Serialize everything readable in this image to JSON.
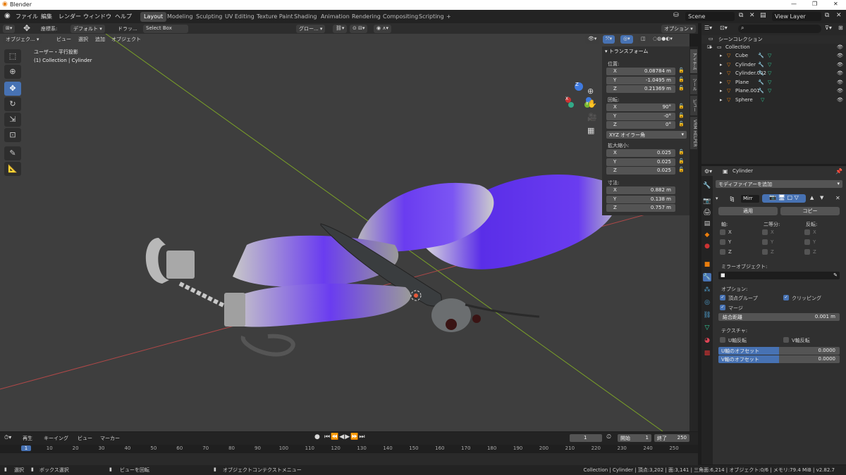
{
  "app": {
    "title": "Blender",
    "icon": "blender-logo"
  },
  "menu": {
    "items": [
      "ファイル",
      "編集",
      "レンダー",
      "ウィンドウ",
      "ヘルプ"
    ],
    "workspaces": [
      "Layout",
      "Modeling",
      "Sculpting",
      "UV Editing",
      "Texture Paint",
      "Shading",
      "Animation",
      "Rendering",
      "Compositing",
      "Scripting"
    ],
    "add_tab": "+",
    "scene": "Scene",
    "view_layer": "View Layer"
  },
  "header": {
    "coord_label": "座標系:",
    "coord_value": "デフォルト",
    "drag_label": "ドラッ...",
    "drag_value": "Select Box",
    "pivot": "グロー...",
    "options": "オプション"
  },
  "viewport": {
    "mode": "オブジェク...",
    "menus": [
      "ビュー",
      "選択",
      "追加",
      "オブジェクト"
    ],
    "overlay_title": "ユーザー・平行投影",
    "overlay_sub": "(1) Collection | Cylinder",
    "axes": {
      "x": "X",
      "y": "Y",
      "z": "Z"
    }
  },
  "npanel": {
    "section": "トランスフォーム",
    "location_label": "位置:",
    "location": [
      {
        "axis": "X",
        "value": "0.08784 m"
      },
      {
        "axis": "Y",
        "value": "-1.0495 m"
      },
      {
        "axis": "Z",
        "value": "0.21369 m"
      }
    ],
    "rotation_label": "回転:",
    "rotation": [
      {
        "axis": "X",
        "value": "90°"
      },
      {
        "axis": "Y",
        "value": "-0°"
      },
      {
        "axis": "Z",
        "value": "0°"
      }
    ],
    "rot_mode": "XYZ オイラー角",
    "scale_label": "拡大縮小:",
    "scale": [
      {
        "axis": "X",
        "value": "0.025"
      },
      {
        "axis": "Y",
        "value": "0.025"
      },
      {
        "axis": "Z",
        "value": "0.025"
      }
    ],
    "dims_label": "寸法:",
    "dims": [
      {
        "axis": "X",
        "value": "0.882 m"
      },
      {
        "axis": "Y",
        "value": "0.138 m"
      },
      {
        "axis": "Z",
        "value": "0.757 m"
      }
    ],
    "tabs": [
      "アイテム",
      "ツール",
      "ビュー",
      "VRM HELPER"
    ]
  },
  "outliner": {
    "root": "シーンコレクション",
    "collection": "Collection",
    "objects": [
      "Cube",
      "Cylinder",
      "Cylinder.002",
      "Plane",
      "Plane.001",
      "Sphere"
    ]
  },
  "properties": {
    "object": "Cylinder",
    "add_modifier": "モディファイアーを追加",
    "mod_name": "Mirr",
    "apply": "適用",
    "copy": "コピー",
    "axis_label": "軸:",
    "bisect_label": "二等分:",
    "flip_label": "反転:",
    "xyz": [
      "X",
      "Y",
      "Z"
    ],
    "mirror_obj": "ミラーオブジェクト:",
    "options_label": "オプション:",
    "vgroups": "頂点グループ",
    "clipping": "クリッピング",
    "merge": "マージ",
    "merge_dist_label": "結合距離",
    "merge_dist": "0.001 m",
    "texture_label": "テクスチャ:",
    "u_flip": "U軸反転",
    "v_flip": "V軸反転",
    "u_offset_label": "U軸のオフセット",
    "u_offset": "0.0000",
    "v_offset_label": "V軸のオフセット",
    "v_offset": "0.0000"
  },
  "timeline": {
    "menus": [
      "再生",
      "キーイング",
      "ビュー",
      "マーカー"
    ],
    "current": "1",
    "start_label": "開始",
    "start": "1",
    "end_label": "終了",
    "end": "250",
    "ticks": [
      "1",
      "10",
      "20",
      "30",
      "40",
      "50",
      "60",
      "70",
      "80",
      "90",
      "100",
      "110",
      "120",
      "130",
      "140",
      "150",
      "160",
      "170",
      "180",
      "190",
      "200",
      "210",
      "220",
      "230",
      "240",
      "250"
    ]
  },
  "status": {
    "select": "選択",
    "box": "ボックス選択",
    "rotate": "ビューを回転",
    "context": "オブジェクトコンテクストメニュー",
    "info": "Collection | Cylinder | 頂点:3,202 | 面:3,141 | 三角面:6,214 | オブジェクト:0/6 | メモリ:79.4 MiB | v2.82.7"
  },
  "colors": {
    "accent": "#4772b3",
    "wing": "#6a3cf0",
    "xaxis": "#c04a4a",
    "yaxis": "#7aa028"
  }
}
